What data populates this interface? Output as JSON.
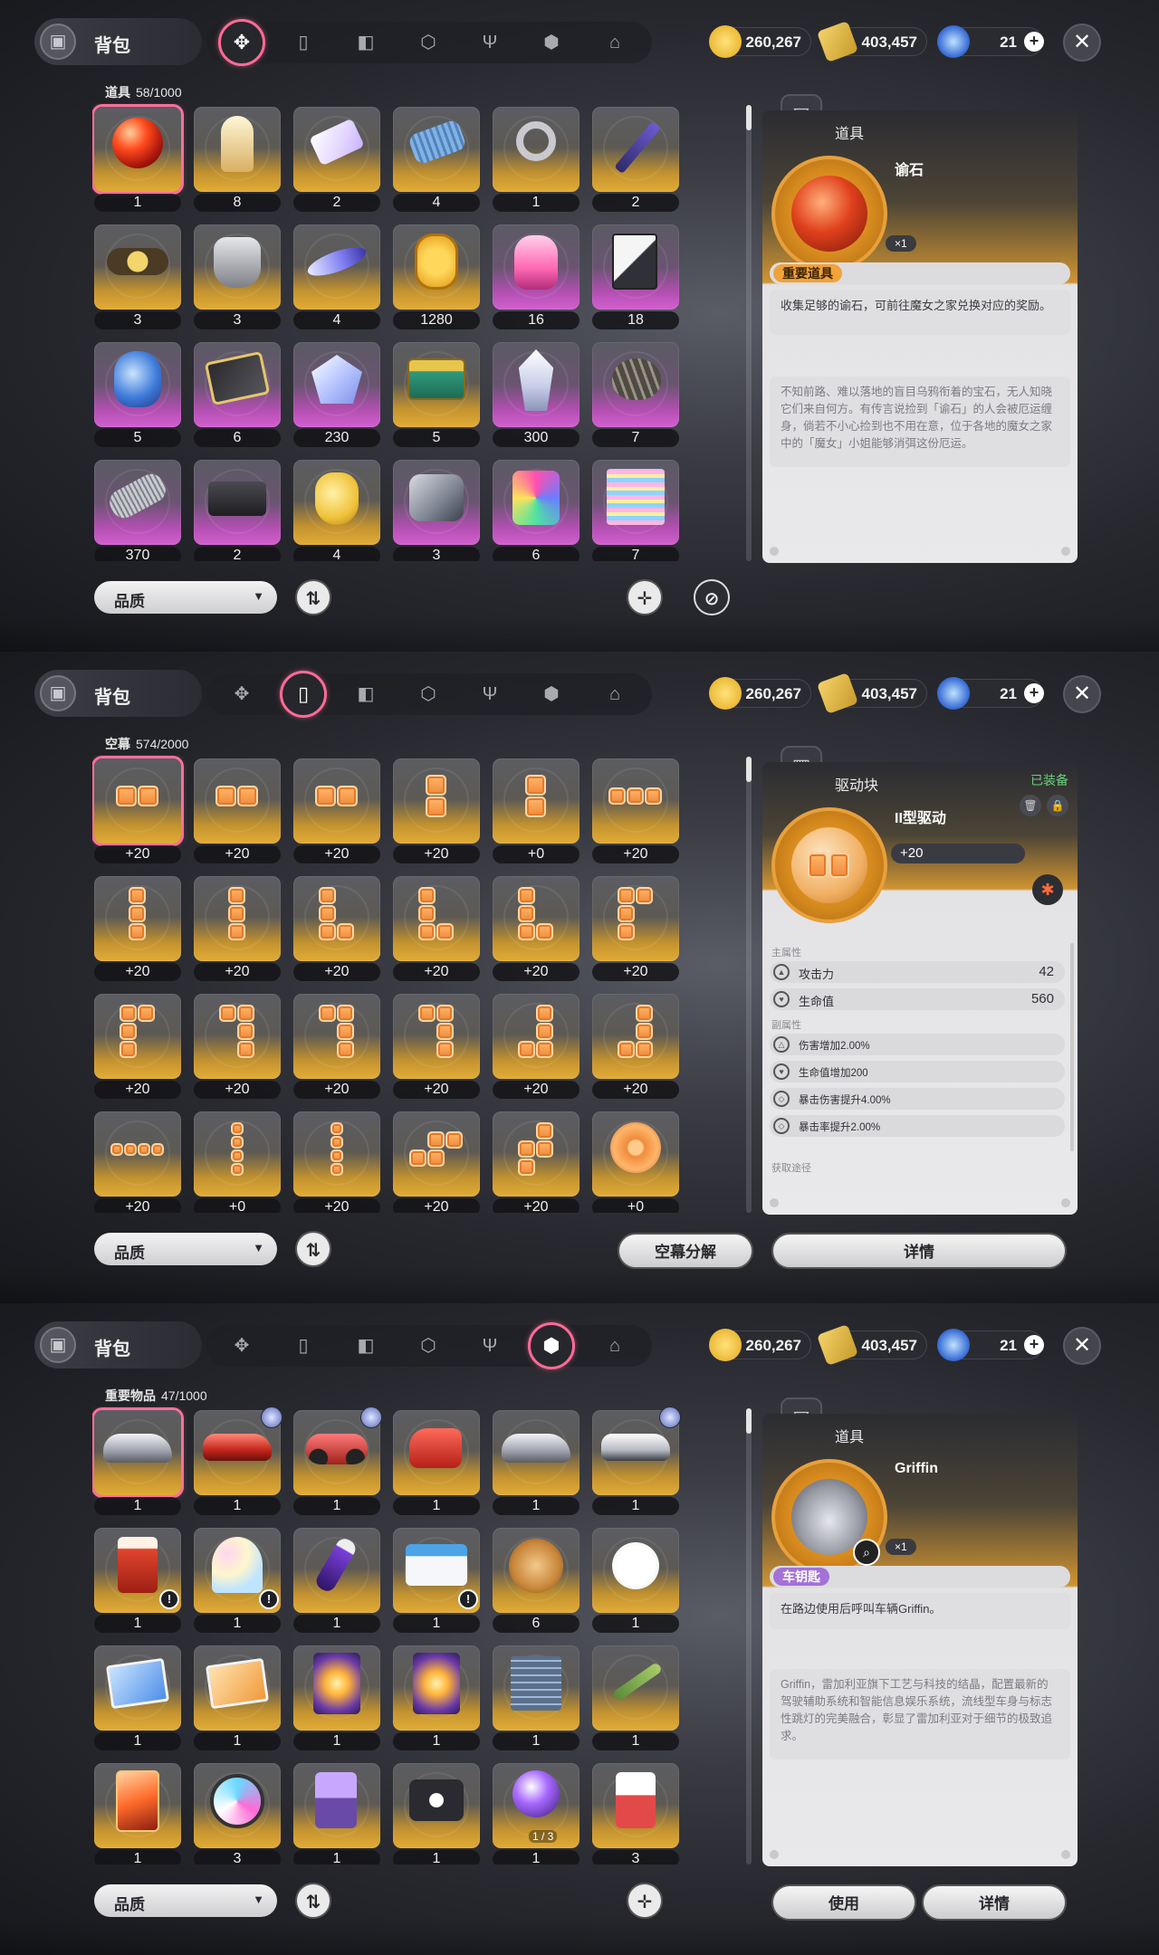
{
  "common": {
    "bag_title": "背包",
    "gold": "260,267",
    "ticket": "403,457",
    "crystal": "21",
    "quality_label": "品质",
    "close_symbol": "✕",
    "colors": {
      "accent_pink": "#ff6b96",
      "gold_card": "#e2ac36",
      "purple_card": "#d260cf",
      "equipped_green": "#69d27a"
    }
  },
  "tab_icons": [
    "pinwheel-icon",
    "gamepad-icon",
    "book-icon",
    "cube-icon",
    "fork-knife-icon",
    "box-icon",
    "home-icon"
  ],
  "panels": [
    {
      "active_tab": 0,
      "inventory_label": "道具",
      "inventory_count": "58/1000",
      "items": [
        {
          "count": "1",
          "icon": "red-orb-icon",
          "rarity": "gold",
          "selected": true
        },
        {
          "count": "8",
          "icon": "chess-piece-icon",
          "rarity": "gold"
        },
        {
          "count": "2",
          "icon": "ticket-icon",
          "rarity": "gold"
        },
        {
          "count": "4",
          "icon": "thread-spool-icon",
          "rarity": "gold"
        },
        {
          "count": "1",
          "icon": "key-icon",
          "rarity": "gold"
        },
        {
          "count": "2",
          "icon": "scissors-icon",
          "rarity": "gold"
        },
        {
          "count": "3",
          "icon": "belt-icon",
          "rarity": "gold"
        },
        {
          "count": "3",
          "icon": "armor-icon",
          "rarity": "gold"
        },
        {
          "count": "4",
          "icon": "feather-ship-icon",
          "rarity": "gold"
        },
        {
          "count": "1280",
          "icon": "gold-coin-icon",
          "rarity": "gold"
        },
        {
          "count": "16",
          "icon": "candy-bag-icon",
          "rarity": "purple"
        },
        {
          "count": "18",
          "icon": "cards-icon",
          "rarity": "purple"
        },
        {
          "count": "5",
          "icon": "blue-vase-icon",
          "rarity": "purple"
        },
        {
          "count": "6",
          "icon": "jewel-box-icon",
          "rarity": "purple"
        },
        {
          "count": "230",
          "icon": "crystal-cluster-icon",
          "rarity": "purple"
        },
        {
          "count": "5",
          "icon": "green-chest-icon",
          "rarity": "gold"
        },
        {
          "count": "300",
          "icon": "ice-crystal-icon",
          "rarity": "purple"
        },
        {
          "count": "7",
          "icon": "seed-icon",
          "rarity": "purple"
        },
        {
          "count": "370",
          "icon": "metal-spool-icon",
          "rarity": "purple"
        },
        {
          "count": "2",
          "icon": "black-block-icon",
          "rarity": "purple"
        },
        {
          "count": "4",
          "icon": "yellow-bottle-icon",
          "rarity": "gold"
        },
        {
          "count": "3",
          "icon": "robot-part-icon",
          "rarity": "purple"
        },
        {
          "count": "6",
          "icon": "paint-can-icon",
          "rarity": "purple"
        },
        {
          "count": "7",
          "icon": "glitch-scroll-icon",
          "rarity": "purple"
        }
      ],
      "detail": {
        "type": "item",
        "category": "道具",
        "name": "谕石",
        "qty": "×1",
        "tag": "重要道具",
        "tag_color": "orange",
        "icon": "red-orb-icon",
        "description": "收集足够的谕石，可前往魔女之家兑换对应的奖励。",
        "lore": "不知前路、难以落地的盲目乌鸦衔着的宝石，无人知晓它们来自何方。有传言说捡到「谕石」的人会被厄运缠身，倘若不小心捡到也不用在意，位于各地的魔女之家中的「魔女」小姐能够消弭这份厄运。"
      },
      "buttons": [
        "品质"
      ]
    },
    {
      "active_tab": 1,
      "inventory_label": "空幕",
      "inventory_count": "574/2000",
      "items": [
        {
          "count": "+20",
          "shape": "h2",
          "selected": true
        },
        {
          "count": "+20",
          "shape": "h2"
        },
        {
          "count": "+20",
          "shape": "h2"
        },
        {
          "count": "+20",
          "shape": "v2"
        },
        {
          "count": "+0",
          "shape": "v2"
        },
        {
          "count": "+20",
          "shape": "h3"
        },
        {
          "count": "+20",
          "shape": "v3"
        },
        {
          "count": "+20",
          "shape": "v3"
        },
        {
          "count": "+20",
          "shape": "L"
        },
        {
          "count": "+20",
          "shape": "L"
        },
        {
          "count": "+20",
          "shape": "L"
        },
        {
          "count": "+20",
          "shape": "Lr"
        },
        {
          "count": "+20",
          "shape": "Lr"
        },
        {
          "count": "+20",
          "shape": "Jr"
        },
        {
          "count": "+20",
          "shape": "Jr"
        },
        {
          "count": "+20",
          "shape": "Jr"
        },
        {
          "count": "+20",
          "shape": "J"
        },
        {
          "count": "+20",
          "shape": "J"
        },
        {
          "count": "+20",
          "shape": "h4"
        },
        {
          "count": "+0",
          "shape": "v4"
        },
        {
          "count": "+20",
          "shape": "v4"
        },
        {
          "count": "+20",
          "shape": "S"
        },
        {
          "count": "+20",
          "shape": "Z"
        },
        {
          "count": "+0",
          "shape": "disc"
        }
      ],
      "detail": {
        "type": "drive",
        "category": "驱动块",
        "equipped": "已装备",
        "name": "II型驱动",
        "level": "+20",
        "main_title": "主属性",
        "main_stats": [
          {
            "name": "攻击力",
            "value": "42",
            "icon": "attack-icon"
          },
          {
            "name": "生命值",
            "value": "560",
            "icon": "heart-icon"
          }
        ],
        "sub_title": "副属性",
        "sub_stats": [
          {
            "name": "伤害增加2.00%",
            "icon": "triangle-icon"
          },
          {
            "name": "生命值增加200",
            "icon": "heart-icon"
          },
          {
            "name": "暴击伤害提升4.00%",
            "icon": "crit-icon"
          },
          {
            "name": "暴击率提升2.00%",
            "icon": "crit-icon"
          }
        ],
        "source_title": "获取途径"
      },
      "buttons": [
        "品质",
        "空幕分解",
        "详情"
      ]
    },
    {
      "active_tab": 5,
      "inventory_label": "重要物品",
      "inventory_count": "47/1000",
      "items": [
        {
          "count": "1",
          "icon": "silver-car-icon",
          "selected": true
        },
        {
          "count": "1",
          "icon": "red-car-icon",
          "badge": true
        },
        {
          "count": "1",
          "icon": "motorcycle-icon",
          "badge": true
        },
        {
          "count": "1",
          "icon": "scooter-icon"
        },
        {
          "count": "1",
          "icon": "silver-car-icon"
        },
        {
          "count": "1",
          "icon": "white-car-icon",
          "badge": true
        },
        {
          "count": "1",
          "icon": "juice-pack-icon",
          "warn": true
        },
        {
          "count": "1",
          "icon": "ice-cream-icon",
          "warn": true
        },
        {
          "count": "1",
          "icon": "vial-icon"
        },
        {
          "count": "1",
          "icon": "id-card-icon",
          "warn": true
        },
        {
          "count": "6",
          "icon": "bronze-coin-icon"
        },
        {
          "count": "1",
          "icon": "bunny-icon"
        },
        {
          "count": "1",
          "icon": "blue-photo-icon"
        },
        {
          "count": "1",
          "icon": "orange-photo-icon"
        },
        {
          "count": "1",
          "icon": "glow-card-icon"
        },
        {
          "count": "1",
          "icon": "glow-card-icon"
        },
        {
          "count": "1",
          "icon": "circuit-board-icon"
        },
        {
          "count": "1",
          "icon": "branch-icon"
        },
        {
          "count": "1",
          "icon": "flame-card-icon"
        },
        {
          "count": "3",
          "icon": "shuriken-icon"
        },
        {
          "count": "1",
          "icon": "music-player-icon"
        },
        {
          "count": "1",
          "icon": "skull-bag-icon"
        },
        {
          "count": "1",
          "icon": "crystal-ball-icon",
          "sub": "1 / 3"
        },
        {
          "count": "3",
          "icon": "red-card-icon"
        }
      ],
      "detail": {
        "type": "item",
        "category": "道具",
        "name": "Griffin",
        "qty": "×1",
        "tag": "车钥匙",
        "tag_color": "violet",
        "icon": "silver-car-icon",
        "description": "在路边使用后呼叫车辆Griffin。",
        "lore": "Griffin，雷加利亚旗下工艺与科技的结晶，配置最新的驾驶辅助系统和智能信息娱乐系统，流线型车身与标志性跳灯的完美融合，彰显了雷加利亚对于细节的极致追求。"
      },
      "buttons": [
        "品质",
        "使用",
        "详情"
      ]
    }
  ]
}
